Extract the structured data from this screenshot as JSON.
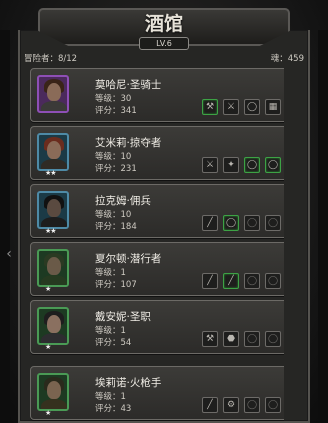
{
  "header": {
    "title": "酒馆",
    "level": "LV.6"
  },
  "info": {
    "adventurers": "冒险者：8/12",
    "souls": "魂：459"
  },
  "heroes": [
    {
      "name": "莫哈尼·圣骑士",
      "level": "等级：30",
      "score": "评分：341",
      "stars": "",
      "rarity_color": "#8e4fb6",
      "slots": [
        "gear-icon",
        "gear-icon",
        "ring-icon",
        "armor-icon"
      ],
      "bookmark": true
    },
    {
      "name": "艾米莉·掠夺者",
      "level": "等级：10",
      "score": "评分：231",
      "stars": "★★",
      "rarity_color": "#4e8aa6",
      "slots": [
        "sword-icon",
        "gear-icon",
        "ring-icon",
        "ring-icon"
      ],
      "bookmark": true
    },
    {
      "name": "拉克姆·佣兵",
      "level": "等级：10",
      "score": "评分：184",
      "stars": "★★",
      "rarity_color": "#4e8aa6",
      "slots": [
        "sword-icon",
        "ring-icon",
        "ring-icon",
        "ring-icon"
      ],
      "bookmark": true
    },
    {
      "name": "夏尔顿·潜行者",
      "level": "等级：1",
      "score": "评分：107",
      "stars": "★",
      "rarity_color": "#4a9a55",
      "slots": [
        "sword-icon",
        "sword-icon",
        "ring-icon",
        "ring-icon"
      ],
      "bookmark": true
    },
    {
      "name": "戴安妮·圣职",
      "level": "等级：1",
      "score": "评分：54",
      "stars": "★",
      "rarity_color": "#4a9a55",
      "slots": [
        "mace-icon",
        "shield-icon",
        "ring-icon",
        "ring-icon"
      ],
      "bookmark": false
    },
    {
      "name": "埃莉诺·火枪手",
      "level": "等级：1",
      "score": "评分：43",
      "stars": "★",
      "rarity_color": "#4a9a55",
      "slots": [
        "gun-icon",
        "gun-icon",
        "ring-icon",
        "ring-icon"
      ],
      "bookmark": false
    }
  ]
}
